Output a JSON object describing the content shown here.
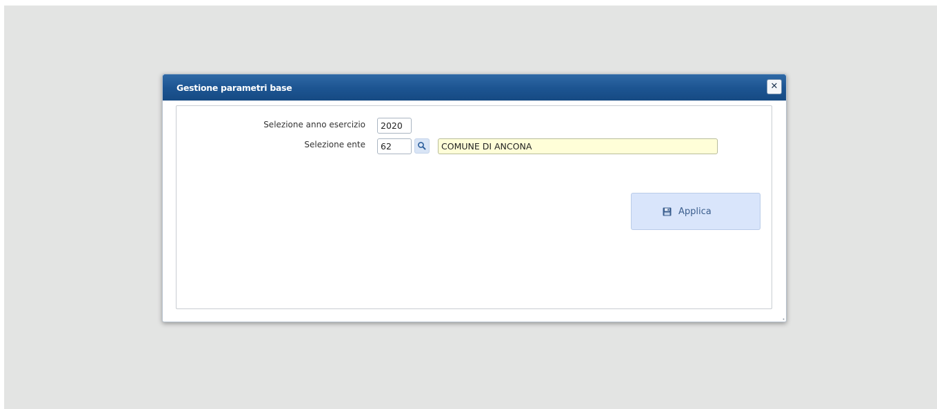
{
  "dialog": {
    "title": "Gestione parametri base",
    "close_icon": "close-icon"
  },
  "form": {
    "anno": {
      "label": "Selezione anno esercizio",
      "value": "2020"
    },
    "ente": {
      "label": "Selezione ente",
      "code_value": "62",
      "search_icon": "search-icon",
      "name_value": "COMUNE DI ANCONA"
    }
  },
  "actions": {
    "apply_label": "Applica",
    "apply_icon": "save-icon"
  },
  "colors": {
    "titlebar": "#1c5491",
    "background": "#e3e4e3",
    "readonly_field": "#fffed8",
    "apply_button": "#d9e5fb"
  }
}
